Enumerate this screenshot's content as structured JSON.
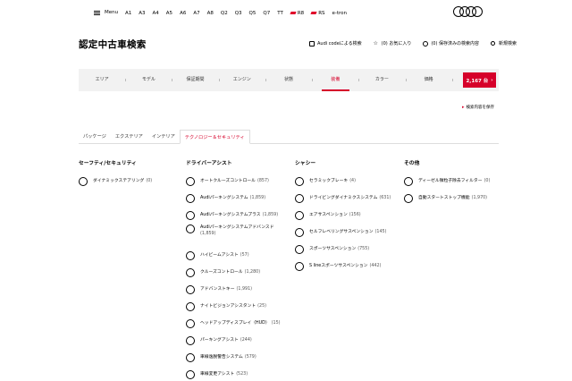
{
  "nav": {
    "menu_label": "Menu",
    "models": [
      "A1",
      "A3",
      "A4",
      "A5",
      "A6",
      "A7",
      "A8",
      "Q2",
      "Q3",
      "Q5",
      "Q7",
      "TT",
      "R8",
      "RS",
      "e-tron"
    ],
    "brand_logo": "audi-rings-icon"
  },
  "header": {
    "title": "認定中古車検索",
    "utilities": [
      {
        "label": "Audi codeによる検索",
        "icon": "audi-code-icon"
      },
      {
        "label": "(0) お気に入り",
        "icon": "star-icon"
      },
      {
        "label": "(0) 保存済みの検索内容",
        "icon": "saved-search-icon"
      },
      {
        "label": "新規検索",
        "icon": "search-icon"
      }
    ]
  },
  "filter_bar": {
    "items": [
      "エリア",
      "モデル",
      "保証期間",
      "エンジン",
      "状態",
      "装備",
      "カラー",
      "価格"
    ],
    "active_item": "装備",
    "result_count": "2,167 台",
    "save_search": "検索内容を保存"
  },
  "tabs": {
    "items": [
      "パッケージ",
      "エクステリア",
      "インテリア",
      "テクノロジー＆セキュリティ"
    ],
    "active": "テクノロジー＆セキュリティ"
  },
  "columns": [
    {
      "title": "セーフティ/セキュリティ",
      "options": [
        {
          "label": "ダイナミックステアリング",
          "count": "(0)"
        }
      ]
    },
    {
      "title": "ドライバーアシスト",
      "options": [
        {
          "label": "オートクルーズコントロール",
          "count": "(857)"
        },
        {
          "label": "Audiパーキングシステム",
          "count": "(1,859)"
        },
        {
          "label": "Audiパーキングシステムプラス",
          "count": "(1,859)"
        },
        {
          "label": "Audiパーキングシステムアドバンスド",
          "count": "(1,859)"
        },
        {
          "label": "ハイビームアシスト",
          "count": "(57)"
        },
        {
          "label": "クルーズコントロール",
          "count": "(1,280)"
        },
        {
          "label": "アドバンストキー",
          "count": "(1,991)"
        },
        {
          "label": "ナイトビジョンアシスタント",
          "count": "(25)"
        },
        {
          "label": "ヘッドアップディスプレイ（HUD）",
          "count": "(15)"
        },
        {
          "label": "パーキングアシスト",
          "count": "(244)"
        },
        {
          "label": "車線逸脱警告システム",
          "count": "(579)"
        },
        {
          "label": "車線変更アシスト",
          "count": "(523)"
        }
      ]
    },
    {
      "title": "シャシー",
      "options": [
        {
          "label": "セラミックブレーキ",
          "count": "(4)"
        },
        {
          "label": "ドライビングダイナミクスシステム",
          "count": "(631)"
        },
        {
          "label": "エアサスペンション",
          "count": "(156)"
        },
        {
          "label": "セルフレベリングサスペンション",
          "count": "(145)"
        },
        {
          "label": "スポーツサスペンション",
          "count": "(755)"
        },
        {
          "label": "S lineスポーツサスペンション",
          "count": "(442)"
        }
      ]
    },
    {
      "title": "その他",
      "options": [
        {
          "label": "ディーゼル微粒子除去フィルター",
          "count": "(0)"
        },
        {
          "label": "自動スタートストップ機能",
          "count": "(1,970)"
        }
      ]
    }
  ],
  "colors": {
    "accent": "#d6002a",
    "filter_bg": "#f2f2f2"
  }
}
